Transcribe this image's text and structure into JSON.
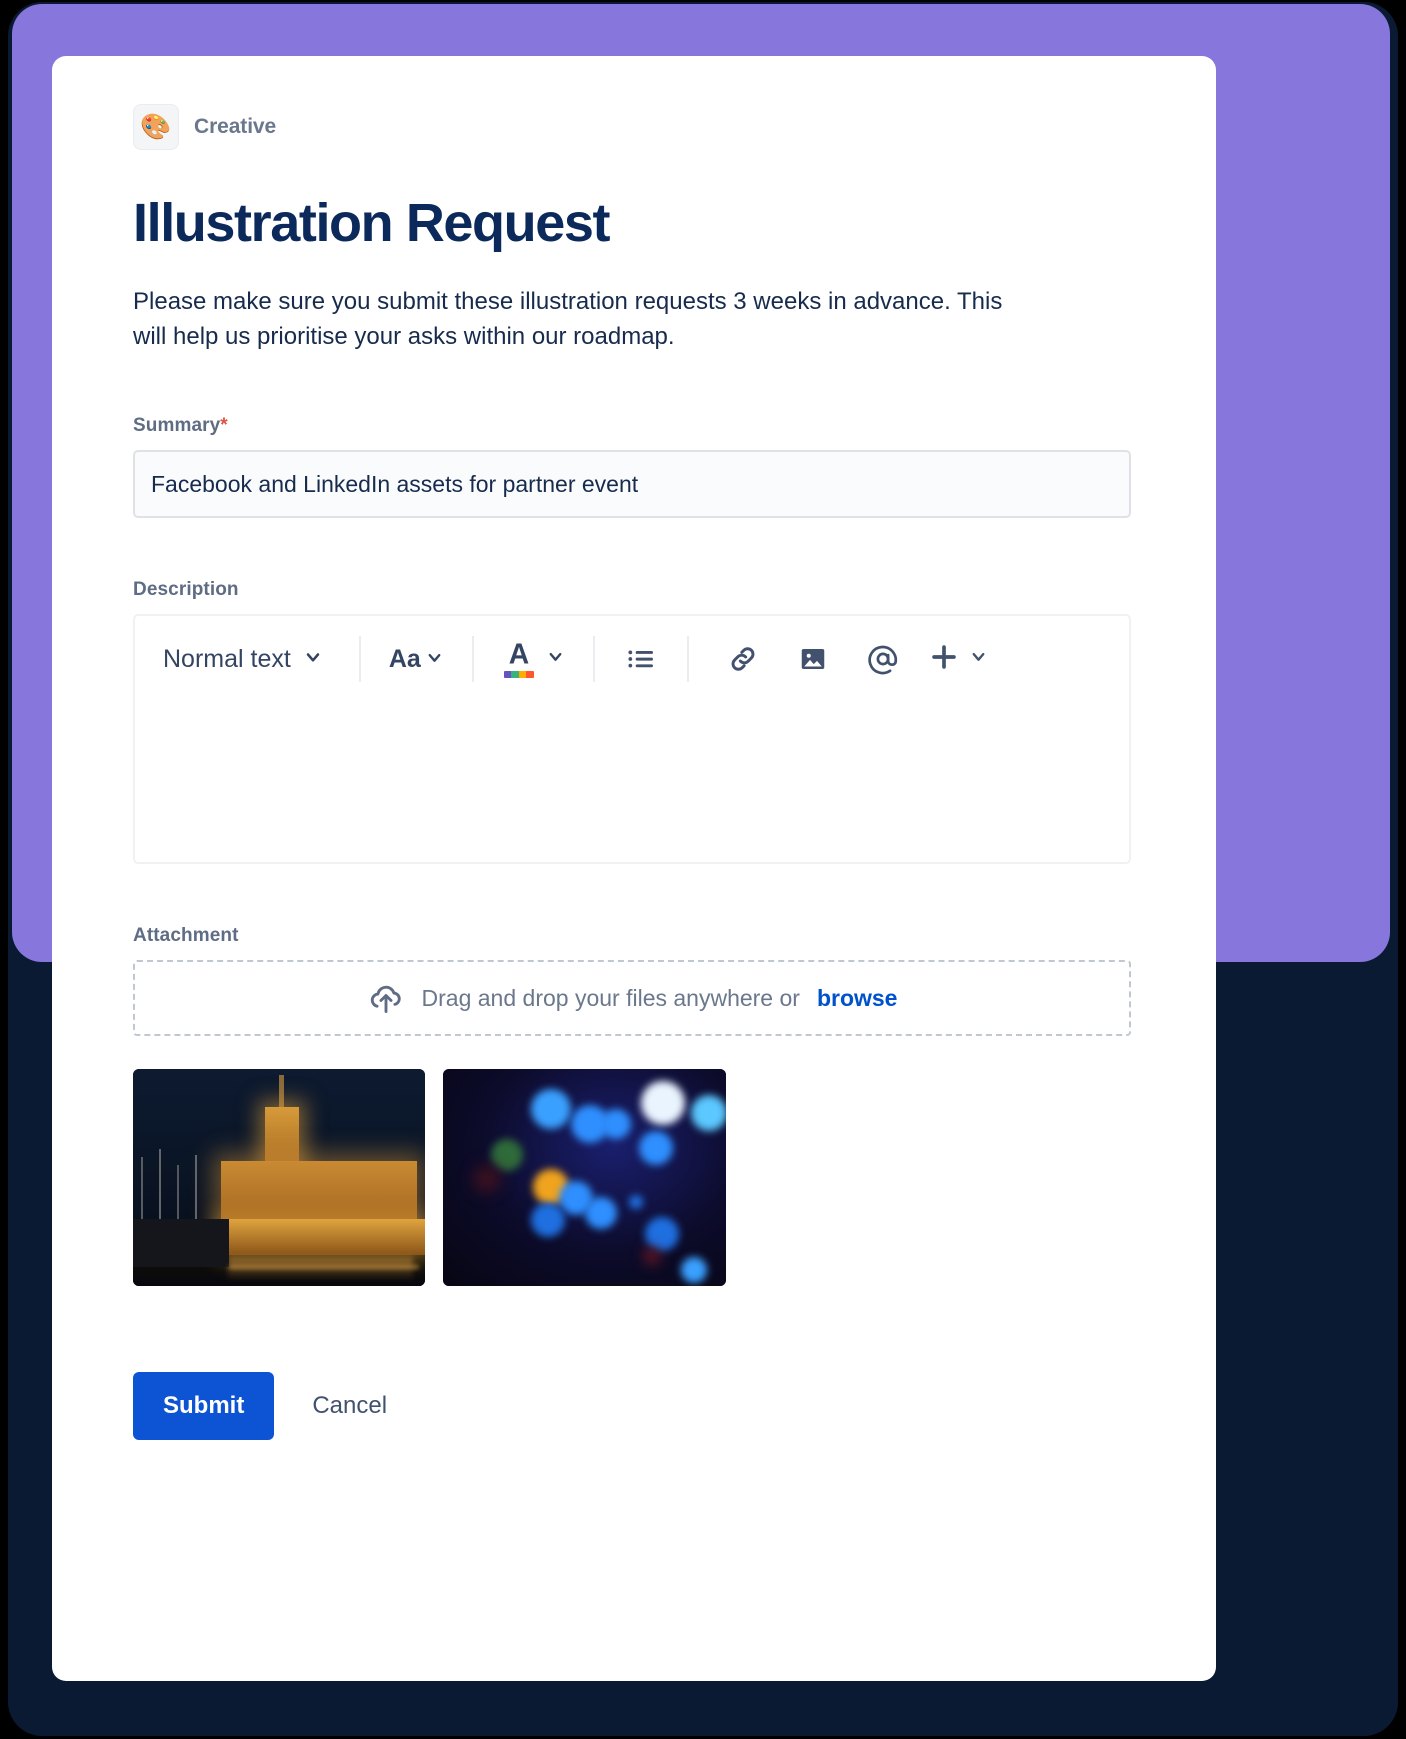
{
  "theme": {
    "banner_purple": "#8777dd",
    "frame_dark": "#0b1a33",
    "title_navy": "#0b2a5b",
    "label_grey": "#5e6c84",
    "required_red": "#de5343",
    "link_blue": "#0052cc",
    "primary_blue": "#0c54d4"
  },
  "project": {
    "icon": "artist-palette",
    "icon_glyph": "🎨",
    "name": "Creative"
  },
  "form": {
    "title": "Illustration Request",
    "intro": "Please make sure you submit these illustration requests 3 weeks in advance. This will help us prioritise your asks within our roadmap."
  },
  "summary_field": {
    "label": "Summary",
    "required_marker": "*",
    "value": "Facebook and LinkedIn assets for partner event",
    "placeholder": ""
  },
  "description_field": {
    "label": "Description",
    "value": "",
    "toolbar": {
      "text_style": {
        "label": "Normal text",
        "icon": "chevron-down-icon"
      },
      "font_size": {
        "label": "Aa",
        "icon": "chevron-down-icon"
      },
      "text_color": {
        "label": "A",
        "icon": "chevron-down-icon",
        "swatches": [
          "#6554c0",
          "#36b37e",
          "#ffab00",
          "#ff5630"
        ]
      },
      "items": [
        {
          "name": "bulleted-list-icon",
          "label": "Bulleted list"
        },
        {
          "name": "link-icon",
          "label": "Link"
        },
        {
          "name": "image-icon",
          "label": "Image"
        },
        {
          "name": "mention-icon",
          "label": "Mention"
        },
        {
          "name": "plus-icon",
          "label": "Insert more"
        }
      ]
    }
  },
  "attachment_field": {
    "label": "Attachment",
    "dropzone": {
      "icon": "cloud-upload-icon",
      "text": "Drag and drop your files anywhere or",
      "browse_label": "browse"
    },
    "thumbnails": [
      {
        "name": "harbour-at-night-thumbnail",
        "alt": "Illuminated waterfront building at night with boats"
      },
      {
        "name": "blue-bokeh-lights-thumbnail",
        "alt": "Blue and orange bokeh lights on dark background"
      }
    ]
  },
  "actions": {
    "submit_label": "Submit",
    "cancel_label": "Cancel"
  }
}
